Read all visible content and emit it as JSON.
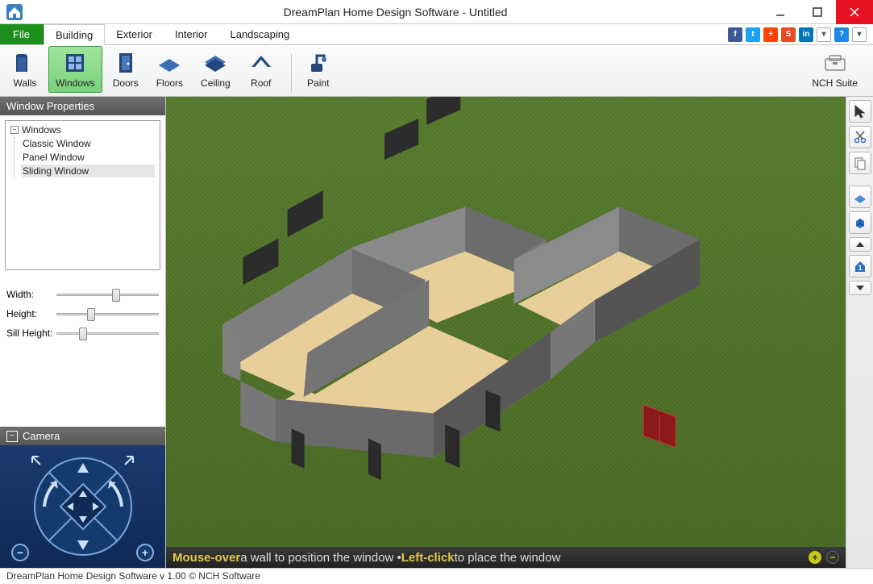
{
  "title": "DreamPlan Home Design Software - Untitled",
  "tabs": {
    "file": "File",
    "building": "Building",
    "exterior": "Exterior",
    "interior": "Interior",
    "landscaping": "Landscaping"
  },
  "ribbon": {
    "walls": "Walls",
    "windows": "Windows",
    "doors": "Doors",
    "floors": "Floors",
    "ceiling": "Ceiling",
    "roof": "Roof",
    "paint": "Paint",
    "nch_suite": "NCH Suite"
  },
  "panel": {
    "title": "Window Properties",
    "tree_root": "Windows",
    "tree_items": [
      "Classic Window",
      "Panel Window",
      "Sliding Window"
    ]
  },
  "sliders": {
    "width": "Width:",
    "height": "Height:",
    "sill": "Sill Height:"
  },
  "camera_title": "Camera",
  "hint": {
    "p1": "Mouse-over",
    "p2": " a wall to position the window • ",
    "p3": "Left-click",
    "p4": " to place the window"
  },
  "status": "DreamPlan Home Design Software v 1.00 © NCH Software"
}
